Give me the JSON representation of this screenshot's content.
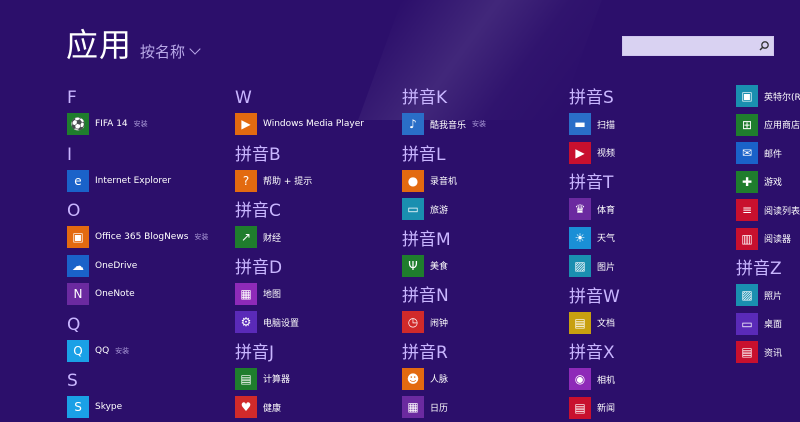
{
  "page": {
    "title": "应用",
    "sort_label": "按名称"
  },
  "search": {
    "placeholder": ""
  },
  "columns": [
    {
      "groups": [
        {
          "letter": "F",
          "apps": [
            {
              "name": "FIFA 14",
              "sub": "安装",
              "color": "#1f7d2d",
              "icon": "soccer-icon",
              "glyph": "⚽"
            }
          ]
        },
        {
          "letter": "I",
          "apps": [
            {
              "name": "Internet Explorer",
              "sub": "",
              "color": "#1a62c9",
              "icon": "ie-logo-icon",
              "glyph": "e"
            }
          ]
        },
        {
          "letter": "O",
          "apps": [
            {
              "name": "Office 365 BlogNews",
              "sub": "安装",
              "color": "#e36a10",
              "icon": "office-icon",
              "glyph": "▣"
            },
            {
              "name": "OneDrive",
              "sub": "",
              "color": "#1a62c9",
              "icon": "cloud-icon",
              "glyph": "☁"
            },
            {
              "name": "OneNote",
              "sub": "",
              "color": "#6b2aa0",
              "icon": "onenote-icon",
              "glyph": "N"
            }
          ]
        },
        {
          "letter": "Q",
          "apps": [
            {
              "name": "QQ",
              "sub": "安装",
              "color": "#1aa0e6",
              "icon": "qq-penguin-icon",
              "glyph": "Q"
            }
          ]
        },
        {
          "letter": "S",
          "apps": [
            {
              "name": "Skype",
              "sub": "",
              "color": "#1aa0e6",
              "icon": "skype-icon",
              "glyph": "S"
            }
          ]
        }
      ]
    },
    {
      "groups": [
        {
          "letter": "W",
          "apps": [
            {
              "name": "Windows Media Player",
              "sub": "",
              "color": "#e36a10",
              "icon": "play-icon",
              "glyph": "▶"
            }
          ]
        },
        {
          "letter": "拼音B",
          "apps": [
            {
              "name": "帮助 + 提示",
              "sub": "",
              "color": "#e36a10",
              "icon": "help-icon",
              "glyph": "?"
            }
          ]
        },
        {
          "letter": "拼音C",
          "apps": [
            {
              "name": "财经",
              "sub": "",
              "color": "#1f7d2d",
              "icon": "finance-chart-icon",
              "glyph": "↗"
            }
          ]
        },
        {
          "letter": "拼音D",
          "apps": [
            {
              "name": "地图",
              "sub": "",
              "color": "#8e2ab8",
              "icon": "map-icon",
              "glyph": "▦"
            },
            {
              "name": "电脑设置",
              "sub": "",
              "color": "#5a2ab8",
              "icon": "gear-icon",
              "glyph": "⚙"
            }
          ]
        },
        {
          "letter": "拼音J",
          "apps": [
            {
              "name": "计算器",
              "sub": "",
              "color": "#1f7d2d",
              "icon": "calculator-icon",
              "glyph": "▤"
            },
            {
              "name": "健康",
              "sub": "",
              "color": "#d12a2a",
              "icon": "heart-icon",
              "glyph": "♥"
            }
          ]
        }
      ]
    },
    {
      "groups": [
        {
          "letter": "拼音K",
          "apps": [
            {
              "name": "酷我音乐",
              "sub": "安装",
              "color": "#2a6ec8",
              "icon": "kuwo-music-icon",
              "glyph": "♪"
            }
          ]
        },
        {
          "letter": "拼音L",
          "apps": [
            {
              "name": "录音机",
              "sub": "",
              "color": "#e36a10",
              "icon": "microphone-icon",
              "glyph": "●"
            },
            {
              "name": "旅游",
              "sub": "",
              "color": "#1a8fb0",
              "icon": "suitcase-icon",
              "glyph": "▭"
            }
          ]
        },
        {
          "letter": "拼音M",
          "apps": [
            {
              "name": "美食",
              "sub": "",
              "color": "#1f7d2d",
              "icon": "fork-knife-icon",
              "glyph": "Ψ"
            }
          ]
        },
        {
          "letter": "拼音N",
          "apps": [
            {
              "name": "闹钟",
              "sub": "",
              "color": "#d12a2a",
              "icon": "alarm-clock-icon",
              "glyph": "◷"
            }
          ]
        },
        {
          "letter": "拼音R",
          "apps": [
            {
              "name": "人脉",
              "sub": "",
              "color": "#e36a10",
              "icon": "people-icon",
              "glyph": "☻"
            },
            {
              "name": "日历",
              "sub": "",
              "color": "#6b2aa0",
              "icon": "calendar-icon",
              "glyph": "▦"
            }
          ]
        }
      ]
    },
    {
      "groups": [
        {
          "letter": "拼音S",
          "apps": [
            {
              "name": "扫描",
              "sub": "",
              "color": "#2a6ec8",
              "icon": "scanner-icon",
              "glyph": "▬"
            },
            {
              "name": "视频",
              "sub": "",
              "color": "#c8102e",
              "icon": "video-icon",
              "glyph": "▶"
            }
          ]
        },
        {
          "letter": "拼音T",
          "apps": [
            {
              "name": "体育",
              "sub": "",
              "color": "#6b2aa0",
              "icon": "trophy-icon",
              "glyph": "♛"
            },
            {
              "name": "天气",
              "sub": "",
              "color": "#1a8fd6",
              "icon": "sun-icon",
              "glyph": "☀"
            },
            {
              "name": "图片",
              "sub": "",
              "color": "#1a8fb0",
              "icon": "photos-icon",
              "glyph": "▨"
            }
          ]
        },
        {
          "letter": "拼音W",
          "apps": [
            {
              "name": "文档",
              "sub": "",
              "color": "#c8a010",
              "icon": "documents-icon",
              "glyph": "▤"
            }
          ]
        },
        {
          "letter": "拼音X",
          "apps": [
            {
              "name": "相机",
              "sub": "",
              "color": "#8e2ab8",
              "icon": "camera-icon",
              "glyph": "◉"
            },
            {
              "name": "新闻",
              "sub": "",
              "color": "#c8102e",
              "icon": "news-icon",
              "glyph": "▤"
            }
          ]
        }
      ]
    },
    {
      "groups": [
        {
          "letter": "",
          "apps": [
            {
              "name": "英特尔(R)",
              "sub": "",
              "color": "#1a8fb0",
              "icon": "intel-icon",
              "glyph": "▣"
            },
            {
              "name": "应用商店",
              "sub": "",
              "color": "#1f7d2d",
              "icon": "store-icon",
              "glyph": "⊞"
            },
            {
              "name": "邮件",
              "sub": "",
              "color": "#1a62c9",
              "icon": "mail-icon",
              "glyph": "✉"
            },
            {
              "name": "游戏",
              "sub": "",
              "color": "#1f7d2d",
              "icon": "gamepad-icon",
              "glyph": "✚"
            },
            {
              "name": "阅读列表",
              "sub": "",
              "color": "#c8102e",
              "icon": "reading-list-icon",
              "glyph": "≡"
            },
            {
              "name": "阅读器",
              "sub": "",
              "color": "#c8102e",
              "icon": "reader-icon",
              "glyph": "▥"
            }
          ]
        },
        {
          "letter": "拼音Z",
          "apps": [
            {
              "name": "照片",
              "sub": "",
              "color": "#1a8fb0",
              "icon": "photo-icon",
              "glyph": "▨"
            },
            {
              "name": "桌面",
              "sub": "",
              "color": "#5a2ab8",
              "icon": "desktop-icon",
              "glyph": "▭"
            },
            {
              "name": "资讯",
              "sub": "",
              "color": "#c8102e",
              "icon": "news-feed-icon",
              "glyph": "▤"
            }
          ]
        }
      ]
    }
  ]
}
